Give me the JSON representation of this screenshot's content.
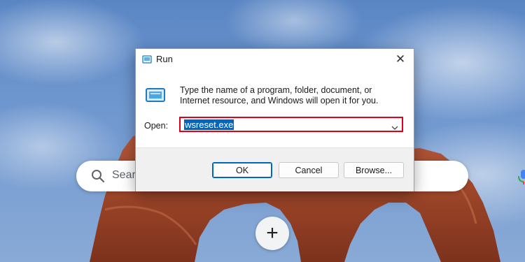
{
  "desktop": {
    "search": {
      "placeholder": "Search Google or type a URL"
    },
    "add_shortcut_symbol": "+"
  },
  "run_dialog": {
    "title": "Run",
    "description": "Type the name of a program, folder, document, or Internet resource, and Windows will open it for you.",
    "open_label": "Open:",
    "open_value": "wsreset.exe",
    "buttons": {
      "ok": "OK",
      "cancel": "Cancel",
      "browse": "Browse..."
    },
    "highlight_color": "#e0001b",
    "accent_color": "#0067c0"
  },
  "icons": {
    "app": "run-icon",
    "close": "close-icon",
    "dropdown": "chevron-down-icon",
    "search": "search-icon",
    "mic": "mic-icon"
  }
}
